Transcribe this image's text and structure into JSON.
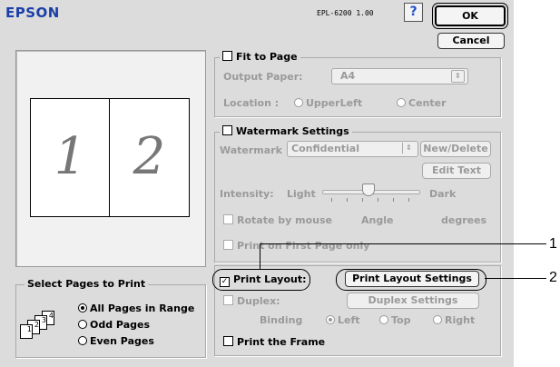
{
  "header": {
    "brand": "EPSON",
    "model": "EPL-6200  1.00",
    "help_icon": "?",
    "ok_label": "OK",
    "cancel_label": "Cancel"
  },
  "preview": {
    "page1": "1",
    "page2": "2"
  },
  "fit_to_page": {
    "label": "Fit to Page",
    "output_paper_label": "Output Paper:",
    "output_paper_value": "A4",
    "location_label": "Location :",
    "location_options": [
      "UpperLeft",
      "Center"
    ]
  },
  "watermark": {
    "label": "Watermark Settings",
    "watermark_label": "Watermark :",
    "watermark_value": "Confidential",
    "new_delete_label": "New/Delete",
    "edit_text_label": "Edit Text",
    "intensity_label": "Intensity:",
    "light_label": "Light",
    "dark_label": "Dark",
    "rotate_label": "Rotate by mouse",
    "angle_label": "Angle",
    "degrees_label": "degrees",
    "first_page_label": "Print on First Page only"
  },
  "layout": {
    "print_layout_label": "Print Layout:",
    "print_layout_checked": true,
    "print_layout_settings_label": "Print Layout Settings",
    "duplex_label": "Duplex:",
    "duplex_settings_label": "Duplex Settings",
    "binding_label": "Binding",
    "binding_options": [
      "Left",
      "Top",
      "Right"
    ],
    "print_frame_label": "Print the Frame"
  },
  "select_pages": {
    "title": "Select Pages to Print",
    "options": [
      "All Pages in Range",
      "Odd Pages",
      "Even Pages"
    ],
    "stack_icon": [
      "1",
      "2",
      "3",
      "4"
    ]
  },
  "callouts": [
    "1",
    "2"
  ]
}
